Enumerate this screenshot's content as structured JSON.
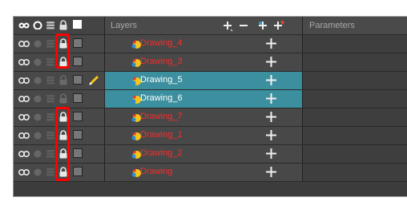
{
  "header": {
    "layers_label": "Layers",
    "parameters_label": "Parameters",
    "column_icons": [
      "show-all-icon",
      "solo-icon",
      "lightbox-icon",
      "lock-all-icon",
      "colour-swatch-icon"
    ],
    "tools": [
      "add-layer-icon",
      "delete-layer-icon",
      "add-peg-icon",
      "add-drawing-icon"
    ]
  },
  "layers": [
    {
      "name": "Drawing_4",
      "locked": true,
      "selected": false,
      "color": "#ff2a2a"
    },
    {
      "name": "Drawing_3",
      "locked": true,
      "selected": false,
      "color": "#ff2a2a"
    },
    {
      "name": "Drawing_5",
      "locked": false,
      "selected": true,
      "color": "#ffffff",
      "editing_icon": "pencil-icon"
    },
    {
      "name": "Drawing_6",
      "locked": false,
      "selected": true,
      "color": "#ffffff"
    },
    {
      "name": "Drawing_7",
      "locked": true,
      "selected": false,
      "color": "#ff2a2a"
    },
    {
      "name": "Drawing_1",
      "locked": true,
      "selected": false,
      "color": "#ff2a2a"
    },
    {
      "name": "Drawing_2",
      "locked": true,
      "selected": false,
      "color": "#ff2a2a"
    },
    {
      "name": "Drawing",
      "locked": true,
      "selected": false,
      "color": "#ff2a2a"
    }
  ],
  "highlight_color": "#ff0000",
  "selection_color": "#3b8f9f"
}
